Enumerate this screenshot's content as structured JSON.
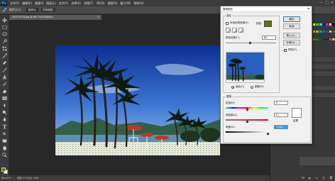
{
  "app": {
    "logo": "Ps"
  },
  "menubar": {
    "items": [
      "文件(F)",
      "编辑(E)",
      "图像(I)",
      "图层(L)",
      "文字(Y)",
      "选择(S)",
      "滤镜(T)",
      "3D(D)",
      "视图(V)",
      "窗口(W)",
      "帮助(H)"
    ]
  },
  "window_controls": {
    "minimize": "—",
    "maximize": "□",
    "close": "✕"
  },
  "options_bar": {
    "sample_size": "取样大小：",
    "sample_value": "取样点",
    "sample_mode": "所有图层"
  },
  "document_tab": {
    "title": "59271578.jpg @ 66.7%(RGB/8#)",
    "close": "×"
  },
  "status_bar": {
    "zoom": "66.67%",
    "doc_info": "文档:1.91M/1.91M"
  },
  "dialog": {
    "title": "替换颜色",
    "close": "✕",
    "selection_legend": "选区",
    "localized_clusters_label": "本地化颜色簇(Z)",
    "color_label": "颜色:",
    "fuzziness_label": "颜色容差(F):",
    "fuzziness_value": "60",
    "selection_radio": "选区(C)",
    "image_radio": "图像(M)",
    "replace_legend": "替换",
    "hue_label": "色相(H):",
    "hue_value": "0",
    "saturation_label": "饱和度(A):",
    "saturation_value": "0",
    "lightness_label": "明度(G):",
    "lightness_value": "+100",
    "result_label": "结果",
    "ok_label": "确定",
    "cancel_label": "取消",
    "load_label": "载入(L)...",
    "save_label": "存储(S)...",
    "preview_label": "预览(P)",
    "preview_checked": true,
    "selected_color": "#5a7412",
    "result_color": "#ffffff"
  },
  "panels": {
    "footer_icons": [
      "fx",
      "◐",
      "▭",
      "◫",
      "🗑"
    ]
  },
  "colors": {
    "foreground": "#5a7412",
    "background": "#ffffff",
    "accent": "#3c7fb1"
  }
}
